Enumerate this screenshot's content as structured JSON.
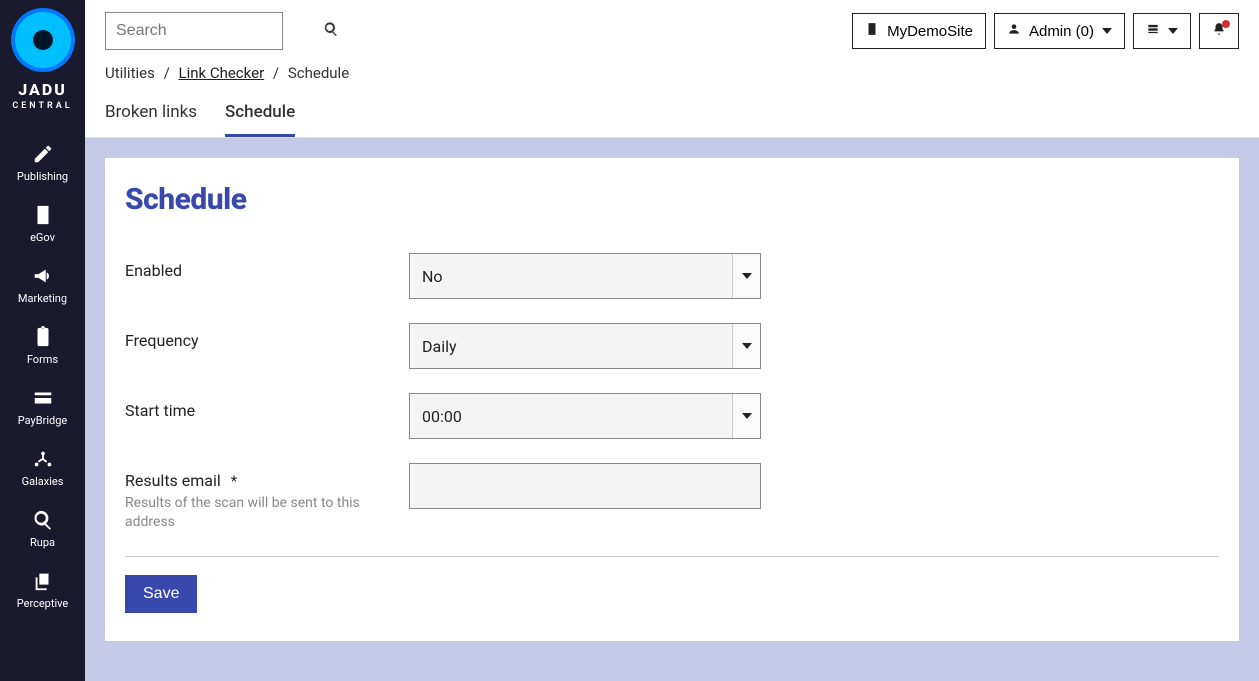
{
  "brand": {
    "name": "JADU",
    "sub": "CENTRAL"
  },
  "sidebar": {
    "items": [
      {
        "label": "Publishing"
      },
      {
        "label": "eGov"
      },
      {
        "label": "Marketing"
      },
      {
        "label": "Forms"
      },
      {
        "label": "PayBridge"
      },
      {
        "label": "Galaxies"
      },
      {
        "label": "Rupa"
      },
      {
        "label": "Perceptive"
      }
    ]
  },
  "search": {
    "placeholder": "Search"
  },
  "header": {
    "site_button": "MyDemoSite",
    "user_button": "Admin (0)"
  },
  "breadcrumb": {
    "root": "Utilities",
    "link": "Link Checker",
    "current": "Schedule"
  },
  "tabs": [
    {
      "label": "Broken links",
      "active": false
    },
    {
      "label": "Schedule",
      "active": true
    }
  ],
  "page": {
    "title": "Schedule",
    "fields": {
      "enabled": {
        "label": "Enabled",
        "value": "No"
      },
      "frequency": {
        "label": "Frequency",
        "value": "Daily"
      },
      "start_time": {
        "label": "Start time",
        "value": "00:00"
      },
      "email": {
        "label": "Results email",
        "required_mark": "*",
        "hint": "Results of the scan will be sent to this address",
        "value": ""
      }
    },
    "save_label": "Save"
  }
}
